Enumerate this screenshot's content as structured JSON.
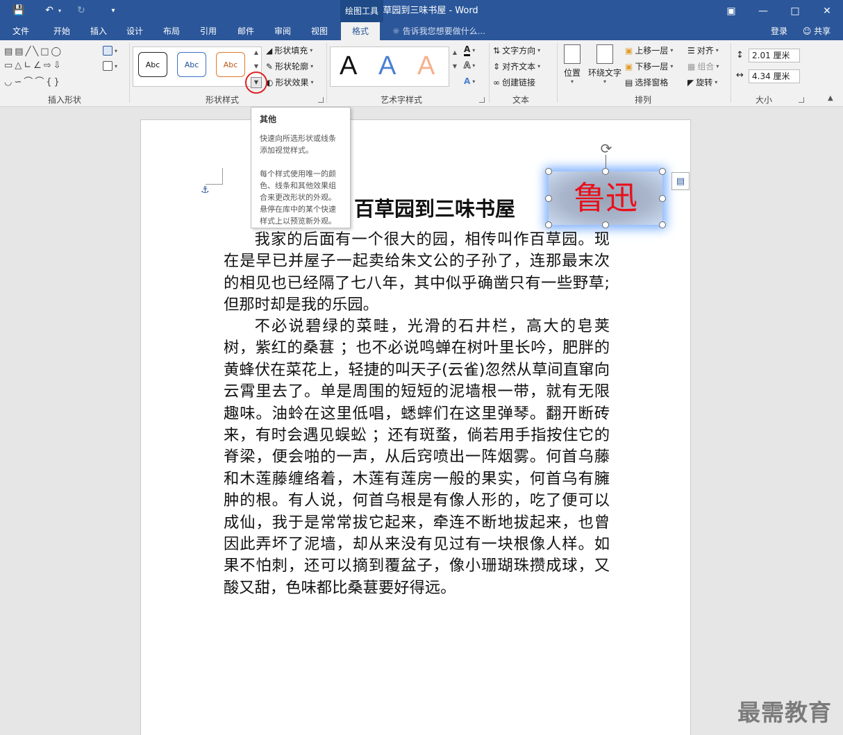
{
  "window": {
    "title": "从百草园到三味书屋 - Word",
    "context_tab_group": "绘图工具"
  },
  "tabs": [
    {
      "label": "文件"
    },
    {
      "label": "开始"
    },
    {
      "label": "插入"
    },
    {
      "label": "设计"
    },
    {
      "label": "布局"
    },
    {
      "label": "引用"
    },
    {
      "label": "邮件"
    },
    {
      "label": "审阅"
    },
    {
      "label": "视图"
    },
    {
      "label": "格式",
      "active": true
    }
  ],
  "tell_me": "告诉我您想要做什么...",
  "account": {
    "login": "登录",
    "share": "共享"
  },
  "ribbon": {
    "insert_shapes": {
      "label": "插入形状"
    },
    "shape_styles": {
      "label": "形状样式",
      "preset_text": "Abc",
      "fill": "形状填充",
      "outline": "形状轮廓",
      "effects": "形状效果"
    },
    "wordart": {
      "label": "艺术字样式",
      "letter": "A"
    },
    "text": {
      "label": "文本",
      "direction": "文字方向",
      "align": "对齐文本",
      "link": "创建链接"
    },
    "arrange": {
      "label": "排列",
      "position": "位置",
      "wrap": "环绕文字",
      "forward": "上移一层",
      "backward": "下移一层",
      "selection_pane": "选择窗格",
      "align": "对齐",
      "group": "组合",
      "rotate": "旋转"
    },
    "size": {
      "label": "大小",
      "height": "2.01 厘米",
      "width": "4.34 厘米"
    }
  },
  "tooltip": {
    "title": "其他",
    "line1": "快速向所选形状或线条添加视觉样式。",
    "line2": "每个样式使用唯一的颜色、线条和其他效果组合来更改形状的外观。悬停在库中的某个快速样式上以预览新外观。"
  },
  "document": {
    "heading": "百草园到三味书屋",
    "textbox": "鲁迅",
    "paragraphs": [
      "我家的后面有一个很大的园，相传叫作百草园。现在是早已并屋子一起卖给朱文公的子孙了，连那最末次的相见也已经隔了七八年，其中似乎确凿只有一些野草;但那时却是我的乐园。",
      "不必说碧绿的菜畦，光滑的石井栏，高大的皂荚树，紫红的桑葚 ；也不必说鸣蝉在树叶里长吟，肥胖的黄蜂伏在菜花上，轻捷的叫天子(云雀)忽然从草间直窜向云霄里去了。单是周围的短短的泥墙根一带，就有无限趣味。油蛉在这里低唱，蟋蟀们在这里弹琴。翻开断砖来，有时会遇见蜈蚣 ；还有斑蝥，倘若用手指按住它的脊梁，便会啪的一声，从后窍喷出一阵烟雾。何首乌藤和木莲藤缠络着，木莲有莲房一般的果实，何首乌有臃肿的根。有人说，何首乌根是有像人形的，吃了便可以成仙，我于是常常拔它起来，牵连不断地拔起来，也曾因此弄坏了泥墙，却从来没有见过有一块根像人样。如果不怕刺，还可以摘到覆盆子，像小珊瑚珠攒成球，又酸又甜，色味都比桑葚要好得远。"
    ]
  },
  "watermark": "最需教育",
  "colors": {
    "titlebar": "#2b579a",
    "ribbon": "#f1f1f1",
    "textbox_text": "#e8101a",
    "highlight_circle": "#e02020"
  }
}
